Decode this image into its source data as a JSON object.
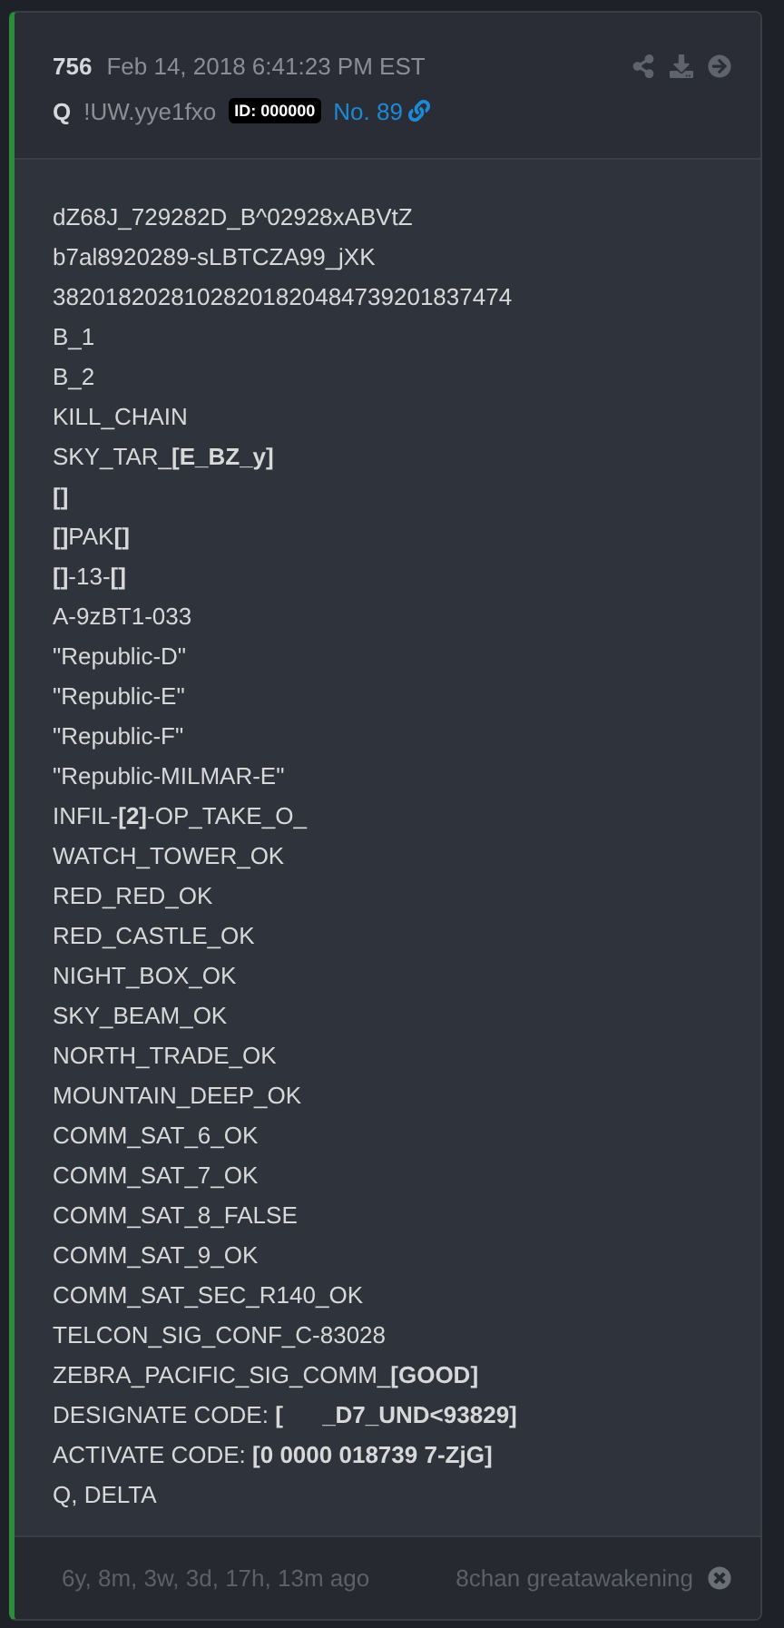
{
  "post": {
    "number": "756",
    "date": "Feb 14, 2018 6:41:23 PM EST",
    "author": "Q",
    "tripcode": "!UW.yye1fxo",
    "id_badge": "ID: 000000",
    "post_link": "No. 89"
  },
  "lines": [
    "dZ68J_729282D_B^02928xABVtZ",
    "b7al8920289-sLBTCZA99_jXK",
    "38201820281028201820484739201837474",
    "B_1",
    "B_2",
    "KILL_CHAIN",
    "SKY_TAR_**[E_BZ_y]**",
    "**[]**",
    "**[]**PAK**[]**",
    "**[]**-13-**[]**",
    "A-9zBT1-033",
    "\"Republic-D\"",
    "\"Republic-E\"",
    "\"Republic-F\"",
    "\"Republic-MILMAR-E\"",
    "INFIL-**[2]**-OP_TAKE_O_",
    "WATCH_TOWER_OK",
    "RED_RED_OK",
    "RED_CASTLE_OK",
    "NIGHT_BOX_OK",
    "SKY_BEAM_OK",
    "NORTH_TRADE_OK",
    "MOUNTAIN_DEEP_OK",
    "COMM_SAT_6_OK",
    "COMM_SAT_7_OK",
    "COMM_SAT_8_FALSE",
    "COMM_SAT_9_OK",
    "COMM_SAT_SEC_R140_OK",
    "TELCON_SIG_CONF_C-83028",
    "ZEBRA_PACIFIC_SIG_COMM_**[GOOD]**",
    "DESIGNATE CODE: **[      _D7_UND<93829]**",
    "ACTIVATE CODE: **[0 0000 018739 7-ZjG]**",
    "Q, DELTA"
  ],
  "footer": {
    "elapsed": "6y, 8m, 3w, 3d, 17h, 13m ago",
    "source": "8chan greatawakening"
  }
}
